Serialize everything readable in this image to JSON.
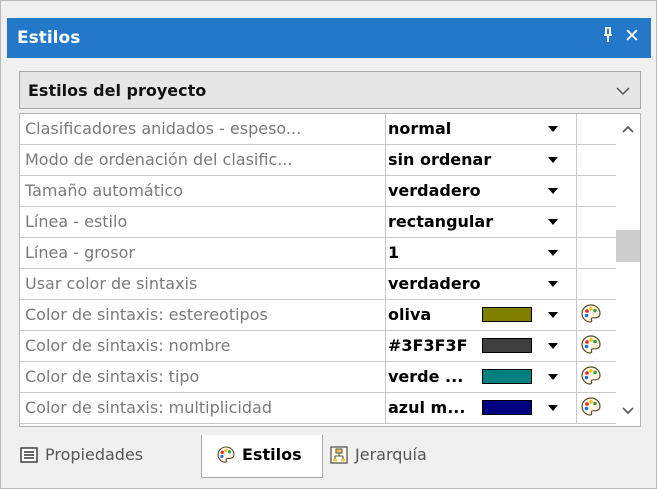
{
  "window": {
    "title": "Estilos",
    "pin_glyph": "ᵖ",
    "close_glyph": "✕"
  },
  "styles_dropdown": {
    "selected": "Estilos del proyecto"
  },
  "rows": [
    {
      "name": "Clasificadores anidados - espeso...",
      "value": "normal",
      "swatch": null,
      "palette": false
    },
    {
      "name": "Modo de ordenación del clasific...",
      "value": "sin ordenar",
      "swatch": null,
      "palette": false
    },
    {
      "name": "Tamaño automático",
      "value": "verdadero",
      "swatch": null,
      "palette": false
    },
    {
      "name": "Línea - estilo",
      "value": "rectangular",
      "swatch": null,
      "palette": false
    },
    {
      "name": "Línea - grosor",
      "value": "1",
      "swatch": null,
      "palette": false
    },
    {
      "name": "Usar color de sintaxis",
      "value": "verdadero",
      "swatch": null,
      "palette": false
    },
    {
      "name": "Color de sintaxis: estereotipos",
      "value": "oliva",
      "swatch": "#808000",
      "palette": true
    },
    {
      "name": "Color de sintaxis: nombre",
      "value": "#3F3F3F",
      "swatch": "#3F3F3F",
      "palette": true
    },
    {
      "name": "Color de sintaxis: tipo",
      "value": "verde ...",
      "swatch": "#008080",
      "palette": true
    },
    {
      "name": "Color de sintaxis: multiplicidad",
      "value": "azul m...",
      "swatch": "#000080",
      "palette": true
    }
  ],
  "tabs": [
    {
      "label": "Propiedades",
      "icon": "list-icon",
      "active": false
    },
    {
      "label": "Estilos",
      "icon": "palette-icon",
      "active": true
    },
    {
      "label": "Jerarquía",
      "icon": "hierarchy-icon",
      "active": false
    }
  ],
  "colors": {
    "titlebar": "#2478c9",
    "accent": "#2478c9"
  }
}
